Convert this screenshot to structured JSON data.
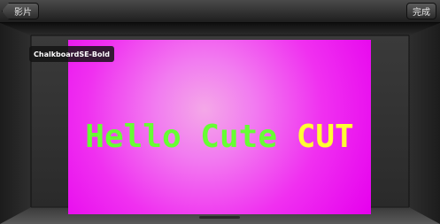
{
  "navbar": {
    "back_label": "影片",
    "done_label": "完成"
  },
  "preview": {
    "text_parts": [
      "Hello Cute ",
      "CUT"
    ],
    "background_color": "#f030f0",
    "text_color_primary": "#66ff33",
    "text_color_secondary": "#ffff33"
  },
  "font_badge": {
    "label": "ChalkboardSE-Bold"
  }
}
